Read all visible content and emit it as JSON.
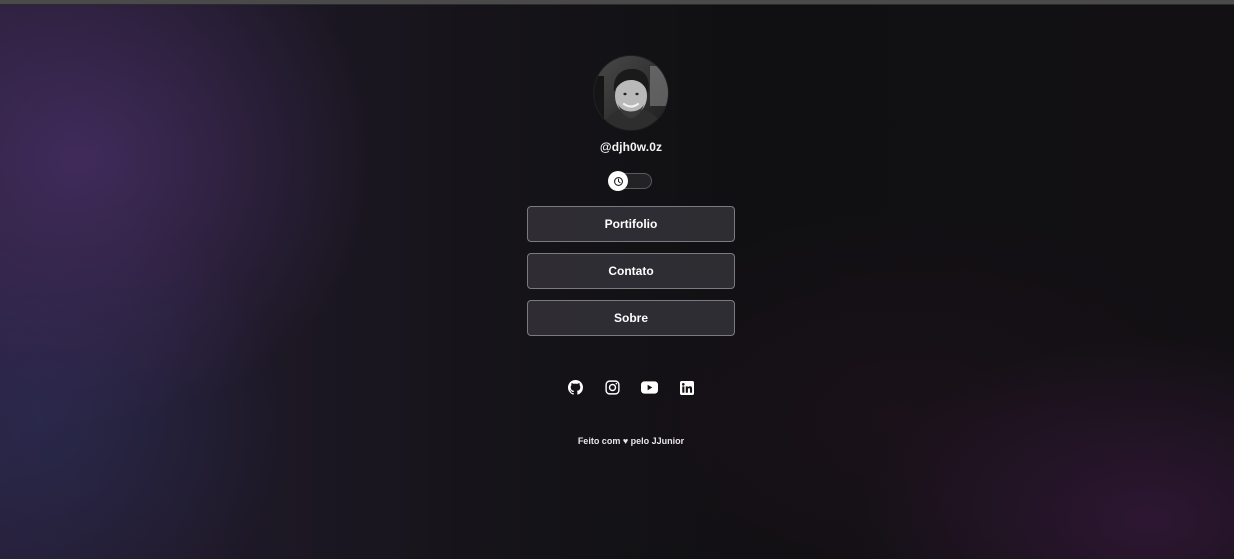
{
  "profile": {
    "handle": "@djh0w.0z",
    "avatar_alt": "profile photo"
  },
  "theme_toggle": {
    "icon": "theme-icon",
    "state": "off"
  },
  "links": [
    {
      "label": "Portifolio"
    },
    {
      "label": "Contato"
    },
    {
      "label": "Sobre"
    }
  ],
  "socials": [
    {
      "icon": "github-icon"
    },
    {
      "icon": "instagram-icon"
    },
    {
      "icon": "youtube-icon"
    },
    {
      "icon": "linkedin-icon"
    }
  ],
  "footer": {
    "text": "Feito com ♥ pelo JJunior"
  },
  "colors": {
    "button_border": "#7a7a80",
    "button_bg": "#343238",
    "accent_purple": "#4a3069"
  }
}
